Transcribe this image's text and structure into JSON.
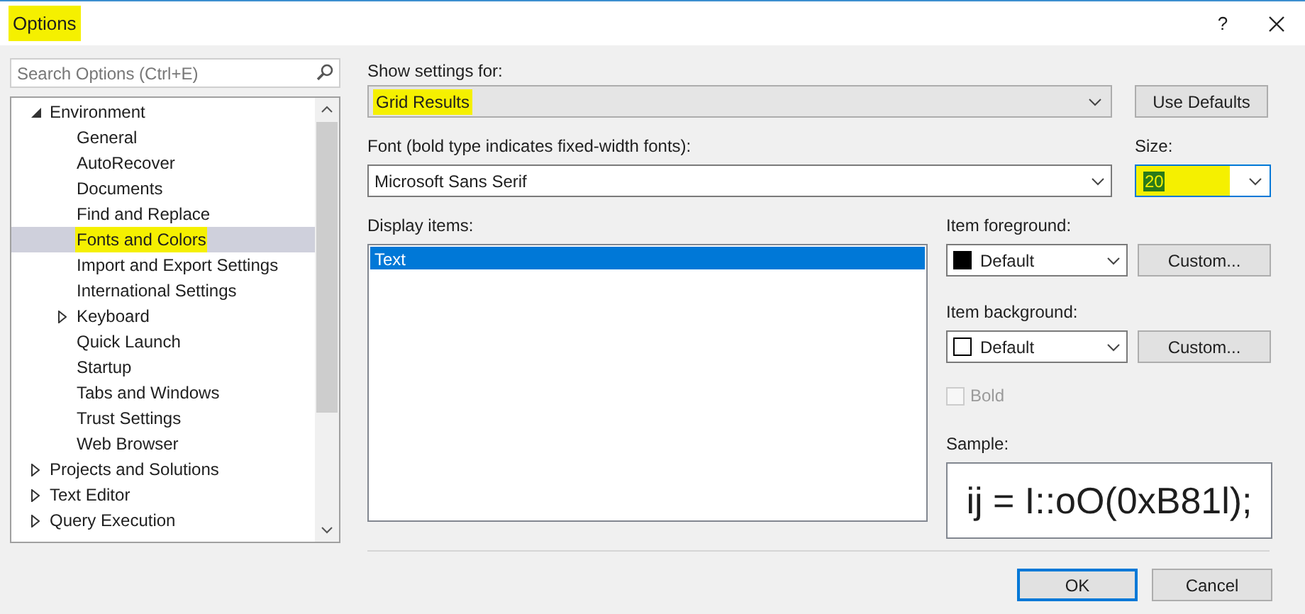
{
  "window": {
    "title": "Options",
    "title_highlighted": true,
    "help": "?"
  },
  "search": {
    "placeholder": "Search Options (Ctrl+E)"
  },
  "tree": [
    {
      "label": "Environment",
      "expanded": true,
      "selected": false,
      "highlighted": false,
      "children": [
        {
          "label": "General",
          "selected": false,
          "highlighted": false
        },
        {
          "label": "AutoRecover",
          "selected": false,
          "highlighted": false
        },
        {
          "label": "Documents",
          "selected": false,
          "highlighted": false
        },
        {
          "label": "Find and Replace",
          "selected": false,
          "highlighted": false
        },
        {
          "label": "Fonts and Colors",
          "selected": true,
          "highlighted": true
        },
        {
          "label": "Import and Export Settings",
          "selected": false,
          "highlighted": false
        },
        {
          "label": "International Settings",
          "selected": false,
          "highlighted": false
        },
        {
          "label": "Keyboard",
          "expanded": false,
          "selected": false,
          "highlighted": false
        },
        {
          "label": "Quick Launch",
          "selected": false,
          "highlighted": false
        },
        {
          "label": "Startup",
          "selected": false,
          "highlighted": false
        },
        {
          "label": "Tabs and Windows",
          "selected": false,
          "highlighted": false
        },
        {
          "label": "Trust Settings",
          "selected": false,
          "highlighted": false
        },
        {
          "label": "Web Browser",
          "selected": false,
          "highlighted": false
        }
      ]
    },
    {
      "label": "Projects and Solutions",
      "expanded": false,
      "selected": false,
      "highlighted": false
    },
    {
      "label": "Text Editor",
      "expanded": false,
      "selected": false,
      "highlighted": false
    },
    {
      "label": "Query Execution",
      "expanded": false,
      "selected": false,
      "highlighted": false
    }
  ],
  "show_settings_for": {
    "label": "Show settings for:",
    "value": "Grid Results",
    "highlighted": true
  },
  "use_defaults": "Use Defaults",
  "font": {
    "label": "Font (bold type indicates fixed-width fonts):",
    "value": "Microsoft Sans Serif"
  },
  "size": {
    "label": "Size:",
    "value": "20",
    "highlighted": true
  },
  "display_items": {
    "label": "Display items:",
    "items": [
      {
        "label": "Text",
        "selected": true
      }
    ]
  },
  "item_foreground": {
    "label": "Item foreground:",
    "value": "Default",
    "color": "#000000",
    "button": "Custom..."
  },
  "item_background": {
    "label": "Item background:",
    "value": "Default",
    "color": "#ffffff",
    "button": "Custom..."
  },
  "bold": {
    "label": "Bold",
    "checked": false,
    "disabled": true
  },
  "sample": {
    "label": "Sample:",
    "text": "ij = I::oO(0xB81l);"
  },
  "buttons": [
    {
      "label": "OK",
      "default": true
    },
    {
      "label": "Cancel",
      "default": false
    }
  ]
}
